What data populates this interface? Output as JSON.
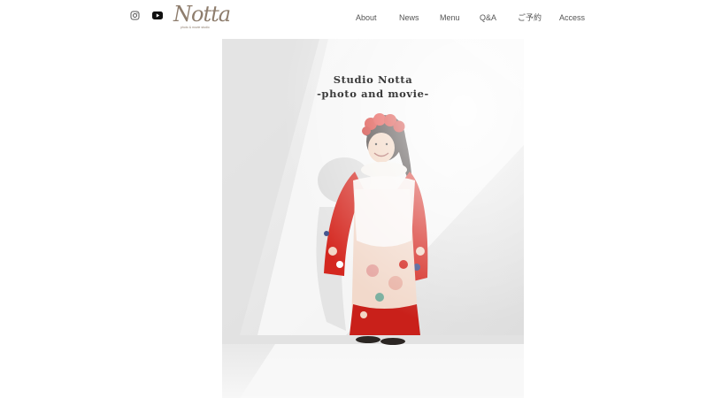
{
  "header": {
    "social": [
      {
        "name": "instagram-icon"
      },
      {
        "name": "youtube-icon"
      }
    ],
    "logo": {
      "script": "Notta",
      "subtitle": "photo & movie studio"
    },
    "nav": [
      {
        "label": "About"
      },
      {
        "label": "News"
      },
      {
        "label": "Menu"
      },
      {
        "label": "Q&A"
      },
      {
        "label": "ご予約"
      },
      {
        "label": "Access"
      }
    ]
  },
  "hero": {
    "title_line1": "Studio Notta",
    "title_line2": "-photo and movie-",
    "image": "child in red and white floral kimono standing against white wall with diagonal shadow"
  },
  "colors": {
    "accent": "#8e7d6d",
    "kimono_red": "#d4271f",
    "text": "#555555"
  }
}
